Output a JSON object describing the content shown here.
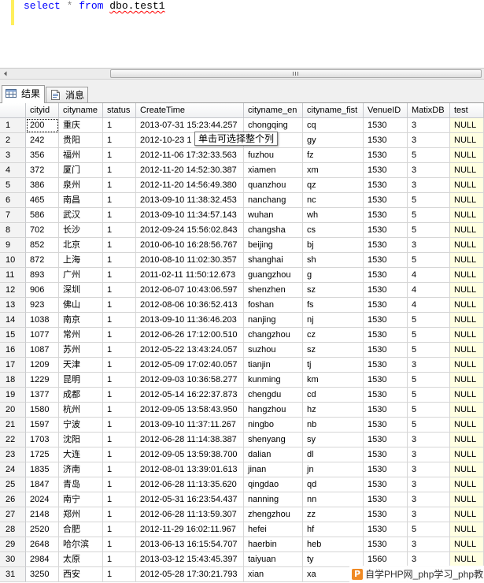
{
  "editor": {
    "query": {
      "keyword_select": "select",
      "star": "*",
      "keyword_from": "from",
      "table": "dbo.test1"
    }
  },
  "tabs": [
    {
      "label": "结果",
      "icon": "grid-icon",
      "active": true
    },
    {
      "label": "消息",
      "icon": "message-icon",
      "active": false
    }
  ],
  "grid": {
    "columns": [
      "cityid",
      "cityname",
      "status",
      "CreateTime",
      "cityname_en",
      "cityname_fist",
      "VenueID",
      "MatixDB",
      "test"
    ],
    "selected_cell": {
      "row": 1,
      "column": "cityid"
    },
    "rows": [
      [
        "1",
        "200",
        "重庆",
        "1",
        "2013-07-31 15:23:44.257",
        "chongqing",
        "cq",
        "1530",
        "3",
        "NULL"
      ],
      [
        "2",
        "242",
        "贵阳",
        "1",
        "2012-10-23 1",
        "",
        "gy",
        "1530",
        "3",
        "NULL"
      ],
      [
        "3",
        "356",
        "福州",
        "1",
        "2012-11-06 17:32:33.563",
        "fuzhou",
        "fz",
        "1530",
        "5",
        "NULL"
      ],
      [
        "4",
        "372",
        "厦门",
        "1",
        "2012-11-20 14:52:30.387",
        "xiamen",
        "xm",
        "1530",
        "3",
        "NULL"
      ],
      [
        "5",
        "386",
        "泉州",
        "1",
        "2012-11-20 14:56:49.380",
        "quanzhou",
        "qz",
        "1530",
        "3",
        "NULL"
      ],
      [
        "6",
        "465",
        "南昌",
        "1",
        "2013-09-10 11:38:32.453",
        "nanchang",
        "nc",
        "1530",
        "5",
        "NULL"
      ],
      [
        "7",
        "586",
        "武汉",
        "1",
        "2013-09-10 11:34:57.143",
        "wuhan",
        "wh",
        "1530",
        "5",
        "NULL"
      ],
      [
        "8",
        "702",
        "长沙",
        "1",
        "2012-09-24 15:56:02.843",
        "changsha",
        "cs",
        "1530",
        "5",
        "NULL"
      ],
      [
        "9",
        "852",
        "北京",
        "1",
        "2010-06-10 16:28:56.767",
        "beijing",
        "bj",
        "1530",
        "3",
        "NULL"
      ],
      [
        "10",
        "872",
        "上海",
        "1",
        "2010-08-10 11:02:30.357",
        "shanghai",
        "sh",
        "1530",
        "5",
        "NULL"
      ],
      [
        "11",
        "893",
        "广州",
        "1",
        "2011-02-11 11:50:12.673",
        "guangzhou",
        "g",
        "1530",
        "4",
        "NULL"
      ],
      [
        "12",
        "906",
        "深圳",
        "1",
        "2012-06-07 10:43:06.597",
        "shenzhen",
        "sz",
        "1530",
        "4",
        "NULL"
      ],
      [
        "13",
        "923",
        "佛山",
        "1",
        "2012-08-06 10:36:52.413",
        "foshan",
        "fs",
        "1530",
        "4",
        "NULL"
      ],
      [
        "14",
        "1038",
        "南京",
        "1",
        "2013-09-10 11:36:46.203",
        "nanjing",
        "nj",
        "1530",
        "5",
        "NULL"
      ],
      [
        "15",
        "1077",
        "常州",
        "1",
        "2012-06-26 17:12:00.510",
        "changzhou",
        "cz",
        "1530",
        "5",
        "NULL"
      ],
      [
        "16",
        "1087",
        "苏州",
        "1",
        "2012-05-22 13:43:24.057",
        "suzhou",
        "sz",
        "1530",
        "5",
        "NULL"
      ],
      [
        "17",
        "1209",
        "天津",
        "1",
        "2012-05-09 17:02:40.057",
        "tianjin",
        "tj",
        "1530",
        "3",
        "NULL"
      ],
      [
        "18",
        "1229",
        "昆明",
        "1",
        "2012-09-03 10:36:58.277",
        "kunming",
        "km",
        "1530",
        "5",
        "NULL"
      ],
      [
        "19",
        "1377",
        "成都",
        "1",
        "2012-05-14 16:22:37.873",
        "chengdu",
        "cd",
        "1530",
        "5",
        "NULL"
      ],
      [
        "20",
        "1580",
        "杭州",
        "1",
        "2012-09-05 13:58:43.950",
        "hangzhou",
        "hz",
        "1530",
        "5",
        "NULL"
      ],
      [
        "21",
        "1597",
        "宁波",
        "1",
        "2013-09-10 11:37:11.267",
        "ningbo",
        "nb",
        "1530",
        "5",
        "NULL"
      ],
      [
        "22",
        "1703",
        "沈阳",
        "1",
        "2012-06-28 11:14:38.387",
        "shenyang",
        "sy",
        "1530",
        "3",
        "NULL"
      ],
      [
        "23",
        "1725",
        "大连",
        "1",
        "2012-09-05 13:59:38.700",
        "dalian",
        "dl",
        "1530",
        "3",
        "NULL"
      ],
      [
        "24",
        "1835",
        "济南",
        "1",
        "2012-08-01 13:39:01.613",
        "jinan",
        "jn",
        "1530",
        "3",
        "NULL"
      ],
      [
        "25",
        "1847",
        "青岛",
        "1",
        "2012-06-28 11:13:35.620",
        "qingdao",
        "qd",
        "1530",
        "3",
        "NULL"
      ],
      [
        "26",
        "2024",
        "南宁",
        "1",
        "2012-05-31 16:23:54.437",
        "nanning",
        "nn",
        "1530",
        "3",
        "NULL"
      ],
      [
        "27",
        "2148",
        "郑州",
        "1",
        "2012-06-28 11:13:59.307",
        "zhengzhou",
        "zz",
        "1530",
        "3",
        "NULL"
      ],
      [
        "28",
        "2520",
        "合肥",
        "1",
        "2012-11-29 16:02:11.967",
        "hefei",
        "hf",
        "1530",
        "5",
        "NULL"
      ],
      [
        "29",
        "2648",
        "哈尔滨",
        "1",
        "2013-06-13 16:15:54.707",
        "haerbin",
        "heb",
        "1530",
        "3",
        "NULL"
      ],
      [
        "30",
        "2984",
        "太原",
        "1",
        "2013-03-12 15:43:45.397",
        "taiyuan",
        "ty",
        "1560",
        "3",
        "NULL"
      ],
      [
        "31",
        "3250",
        "西安",
        "1",
        "2012-05-28 17:30:21.793",
        "xian",
        "xa",
        "",
        "",
        ""
      ]
    ]
  },
  "tooltip": {
    "text": "单击可选择整个列"
  },
  "watermark": {
    "logo": "P",
    "text": "自学PHP网_php学习_php教"
  },
  "colors": {
    "keyword": "#0000ff",
    "operator": "#808080",
    "squiggle": "#ff0000",
    "margin_bar": "#ffef5c",
    "null_cell_bg": "#ffffe1",
    "watermark_logo": "#f08a24"
  }
}
